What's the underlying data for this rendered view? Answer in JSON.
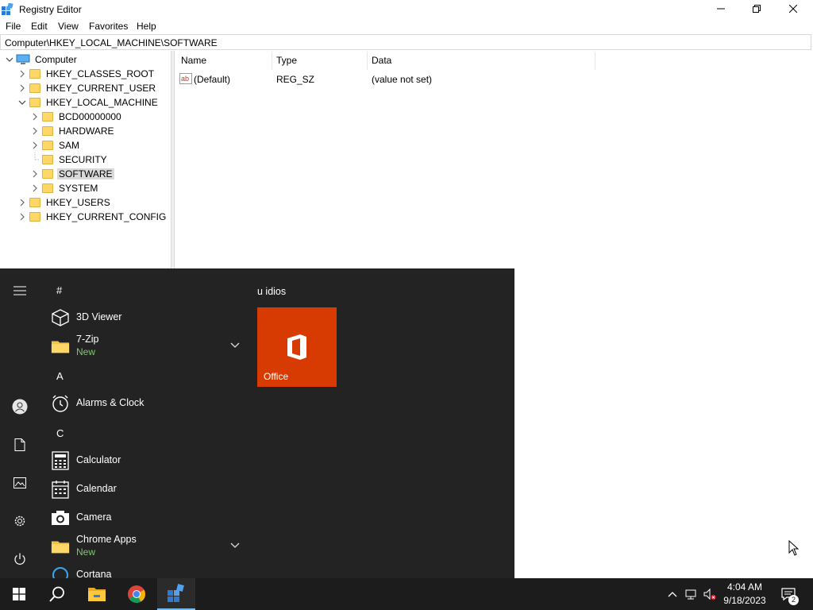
{
  "window": {
    "title": "Registry Editor",
    "menu": [
      "File",
      "Edit",
      "View",
      "Favorites",
      "Help"
    ],
    "address": "Computer\\HKEY_LOCAL_MACHINE\\SOFTWARE"
  },
  "tree": {
    "root": "Computer",
    "hives": [
      "HKEY_CLASSES_ROOT",
      "HKEY_CURRENT_USER",
      "HKEY_LOCAL_MACHINE",
      "HKEY_USERS",
      "HKEY_CURRENT_CONFIG"
    ],
    "hklm_children": [
      "BCD00000000",
      "HARDWARE",
      "SAM",
      "SECURITY",
      "SOFTWARE",
      "SYSTEM"
    ],
    "selected": "SOFTWARE"
  },
  "list": {
    "columns": [
      "Name",
      "Type",
      "Data"
    ],
    "rows": [
      {
        "name": "(Default)",
        "type": "REG_SZ",
        "data": "(value not set)"
      }
    ]
  },
  "start_menu": {
    "letters": [
      "#",
      "A",
      "C"
    ],
    "apps": {
      "viewer3d": "3D Viewer",
      "zip": "7-Zip",
      "zip_badge": "New",
      "alarms": "Alarms & Clock",
      "calculator": "Calculator",
      "calendar": "Calendar",
      "camera": "Camera",
      "chrome_apps": "Chrome Apps",
      "chrome_badge": "New",
      "cortana": "Cortana"
    },
    "tiles_group": "u idios",
    "tile_office": "Office"
  },
  "taskbar": {
    "time": "4:04 AM",
    "date": "9/18/2023",
    "notifications": "2"
  },
  "colors": {
    "start_bg": "#232323",
    "taskbar_bg": "#1c1c1c",
    "office_tile": "#d83b01",
    "accent": "#76b9ed",
    "new_badge": "#7ec96e"
  }
}
